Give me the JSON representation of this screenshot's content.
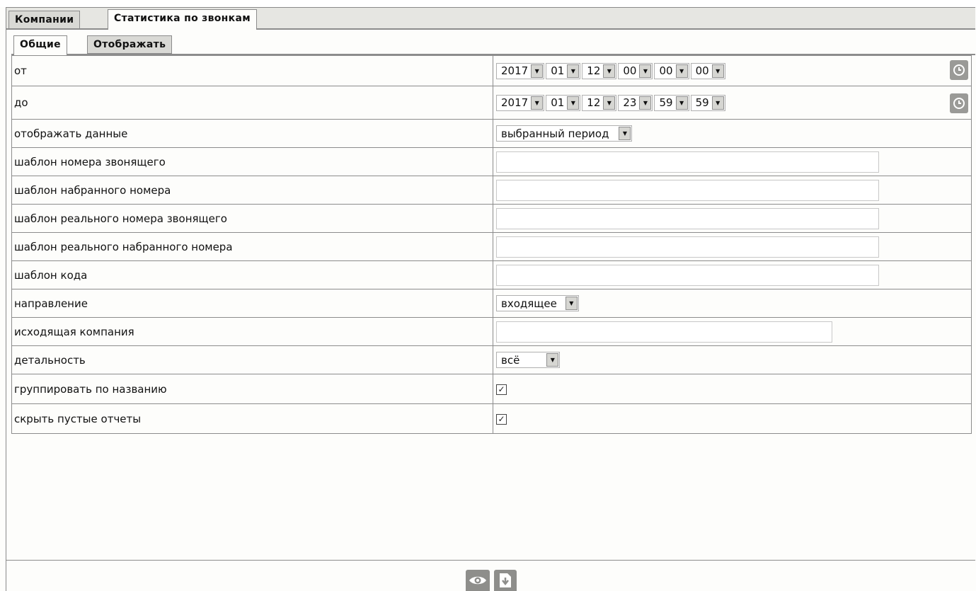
{
  "tabs": [
    {
      "label": "Компании",
      "active": false
    },
    {
      "label": "Статистика по звонкам",
      "active": true
    }
  ],
  "subtabs": [
    {
      "label": "Общие",
      "active": true
    },
    {
      "label": "Отображать",
      "active": false
    }
  ],
  "form": {
    "from": {
      "label": "от",
      "year": "2017",
      "month": "01",
      "day": "12",
      "hour": "00",
      "minute": "00",
      "second": "00"
    },
    "to": {
      "label": "до",
      "year": "2017",
      "month": "01",
      "day": "12",
      "hour": "23",
      "minute": "59",
      "second": "59"
    },
    "display_data": {
      "label": "отображать данные",
      "value": "выбранный период"
    },
    "caller_pattern": {
      "label": "шаблон номера звонящего",
      "value": ""
    },
    "dialed_pattern": {
      "label": "шаблон набранного номера",
      "value": ""
    },
    "real_caller_pattern": {
      "label": "шаблон реального номера звонящего",
      "value": ""
    },
    "real_dialed_pattern": {
      "label": "шаблон реального набранного номера",
      "value": ""
    },
    "code_pattern": {
      "label": "шаблон кода",
      "value": ""
    },
    "direction": {
      "label": "направление",
      "value": "входящее"
    },
    "outgoing_company": {
      "label": "исходящая компания",
      "value": ""
    },
    "detail": {
      "label": "детальность",
      "value": "всё"
    },
    "group_by_name": {
      "label": "группировать по названию",
      "checked": true
    },
    "hide_empty": {
      "label": "скрыть пустые отчеты",
      "checked": true
    }
  },
  "icons": {
    "clock": "clock-icon",
    "view": "eye-icon",
    "export": "download-file-icon",
    "dropdown_arrow": "▼",
    "check": "✓"
  },
  "colors": {
    "border": "#8c8c8c",
    "tab_inactive": "#d9d9d5",
    "button_gray": "#8e8e8b"
  }
}
